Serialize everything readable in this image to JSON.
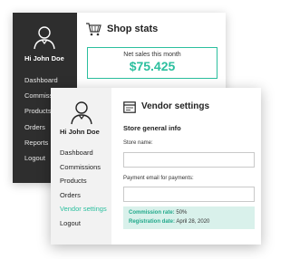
{
  "shop_stats_window": {
    "title": "Shop stats",
    "sidebar": {
      "greeting": "Hi John Doe",
      "items": [
        "Dashboard",
        "Commissions",
        "Products",
        "Orders",
        "Reports",
        "Logout"
      ]
    },
    "net_sales": {
      "label": "Net sales this month",
      "value": "$75.425"
    }
  },
  "vendor_settings_window": {
    "title": "Vendor settings",
    "sidebar": {
      "greeting": "Hi John Doe",
      "items": [
        "Dashboard",
        "Commissions",
        "Products",
        "Orders",
        "Vendor settings",
        "Logout"
      ],
      "active_item": "Vendor settings"
    },
    "section_title": "Store general info",
    "store_name": {
      "label": "Store name:",
      "value": ""
    },
    "payment_email": {
      "label": "Payment email for payments:",
      "value": ""
    },
    "info": {
      "commission_label": "Commission rate:",
      "commission_value": "50%",
      "registration_label": "Registration date:",
      "registration_value": "April 28, 2020"
    }
  },
  "colors": {
    "accent": "#2bbf9e",
    "dark_sidebar": "#2e2e2e",
    "light_sidebar": "#f2f2f2",
    "info_background": "#d9f1eb"
  },
  "icons": [
    "user-avatar-icon",
    "shopping-cart-icon",
    "vendor-card-icon"
  ]
}
